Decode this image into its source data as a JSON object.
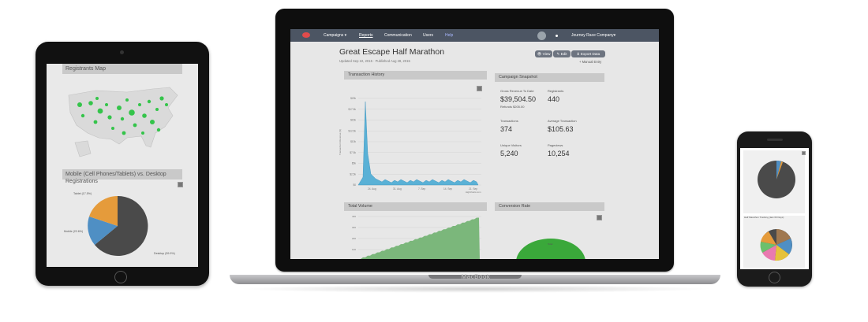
{
  "tablet": {
    "registrants_map": {
      "title": "Registrants Map"
    },
    "device_chart": {
      "title": "Mobile (Cell Phones/Tablets) vs. Desktop Registrations",
      "labels": {
        "tablet": "Tablet (17.5%)",
        "mobile": "Mobile (22.6%)",
        "desktop": "Desktop (59.9%)"
      },
      "colors": {
        "tablet": "#e59b3b",
        "mobile": "#4f8fc4",
        "desktop": "#4a4a4a"
      }
    }
  },
  "laptop": {
    "brand": "MacBook",
    "nav": {
      "campaigns": "Campaigns ▾",
      "reports": "Reports",
      "communication": "Communication",
      "users": "Users",
      "help": "Help",
      "company": "Journey Race Company▾"
    },
    "page": {
      "title": "Great Escape Half Marathon",
      "subtitle": "Updated Sep 22, 2015 · Published Aug 28, 2015",
      "buttons": {
        "view": "👁 View",
        "edit": "✎ Edit",
        "export": "⬇ Export Data"
      },
      "manual_entry": "+ Manual Entry"
    },
    "transaction_history": {
      "title": "Transaction History",
      "ylabel": "Transaction Revenue ($)",
      "y_ticks": [
        "$20k",
        "$17.5k",
        "$15k",
        "$12.5k",
        "$10k",
        "$7.5k",
        "$5k",
        "$2.5k",
        "$0"
      ],
      "x_ticks": [
        "24. Aug",
        "31. Aug",
        "7. Sep",
        "14. Sep",
        "21. Sep"
      ],
      "x_title": "Highcharts.com"
    },
    "snapshot": {
      "title": "Campaign Snapshot",
      "gross_label": "Gross Revenue To Date",
      "gross_value": "$39,504.50",
      "refunds": "Refunds $205.00",
      "registrants_label": "Registrants",
      "registrants_value": "440",
      "transactions_label": "Transactions",
      "transactions_value": "374",
      "avg_label": "Average Transaction",
      "avg_value": "$105.63",
      "visitors_label": "Unique Visitors",
      "visitors_value": "5,240",
      "pageviews_label": "Pageviews",
      "pageviews_value": "10,254"
    },
    "total_volume": {
      "title": "Total Volume",
      "y_ticks": [
        "400",
        "300",
        "200",
        "100"
      ]
    },
    "conversion_rate": {
      "title": "Conversion Rate",
      "label": "Total"
    }
  },
  "phone": {
    "chart2_title": "Half Marathon Tracking (last 60 Days)"
  },
  "colors": {
    "area_blue": "#5ab1d6",
    "area_green": "#7bb77b",
    "dot_green": "#34c44a",
    "conversion_green": "#3aa83a"
  }
}
